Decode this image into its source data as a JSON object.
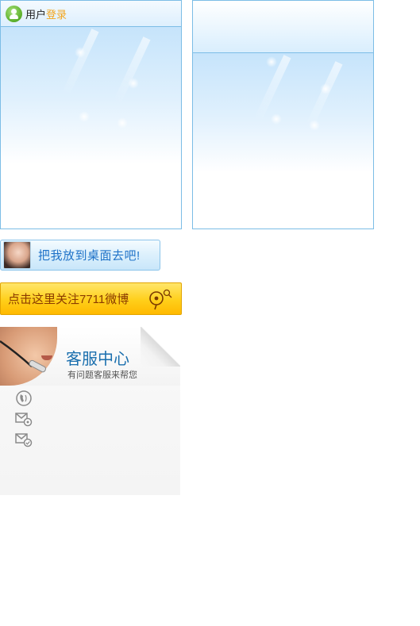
{
  "login_panel": {
    "title_main": "用户",
    "title_accent": "登录"
  },
  "desktop_button": {
    "label": "把我放到桌面去吧!"
  },
  "weibo_button": {
    "label": "点击这里关注7711微博"
  },
  "service_center": {
    "title": "客服中心",
    "subtitle": "有问题客服来帮您"
  },
  "colors": {
    "panel_border": "#7cbde6",
    "accent_orange": "#f3a51c",
    "link_blue": "#1f72c8",
    "weibo_yellow": "#ffcf1a"
  },
  "icons": {
    "user": "user-icon",
    "phone": "phone-icon",
    "mail_settings": "mail-settings-icon",
    "mail_check": "mail-check-icon",
    "weibo": "weibo-icon"
  }
}
